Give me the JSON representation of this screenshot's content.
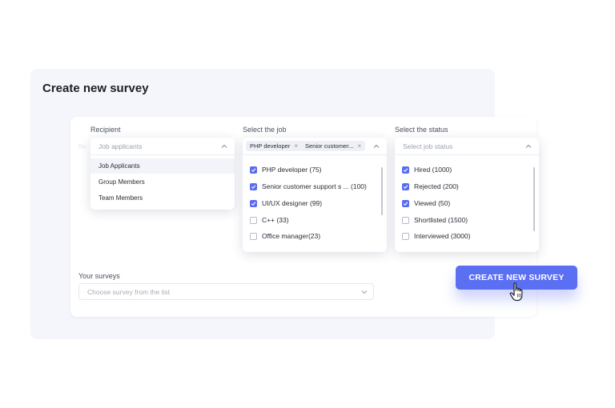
{
  "page": {
    "title": "Create new survey"
  },
  "recipient": {
    "label": "Recipient",
    "placeholder": "Job applicants",
    "options": [
      "Job Applicants",
      "Group Members",
      "Team Members"
    ]
  },
  "job": {
    "label": "Select the job",
    "chips": [
      "PHP developer",
      "Senior customer..."
    ],
    "items": [
      {
        "label": "PHP developer (75)",
        "checked": true
      },
      {
        "label": "Senior customer support s ... (100)",
        "checked": true
      },
      {
        "label": "UI/UX designer (99)",
        "checked": true
      },
      {
        "label": "C++ (33)",
        "checked": false
      },
      {
        "label": "Office manager(23)",
        "checked": false
      }
    ]
  },
  "status": {
    "label": "Select the status",
    "placeholder": "Select job status",
    "items": [
      {
        "label": "Hired (1000)",
        "checked": true
      },
      {
        "label": "Rejected (200)",
        "checked": true
      },
      {
        "label": "Viewed (50)",
        "checked": true
      },
      {
        "label": "Shortlisted (1500)",
        "checked": false
      },
      {
        "label": "Interviewed (3000)",
        "checked": false
      }
    ]
  },
  "surveys": {
    "label": "Your surveys",
    "placeholder": "Choose survey from the list"
  },
  "actions": {
    "create_label": "CREATE NEW SURVEY"
  },
  "colors": {
    "accent": "#5b6ff3",
    "checkbox": "#5a6cf0",
    "panel": "#f5f6fb"
  },
  "icons": {
    "chevron_up": "chevron-up-icon",
    "chevron_down": "chevron-down-icon",
    "cursor": "hand-pointer-icon",
    "remove": "close-icon",
    "check": "check-icon"
  }
}
